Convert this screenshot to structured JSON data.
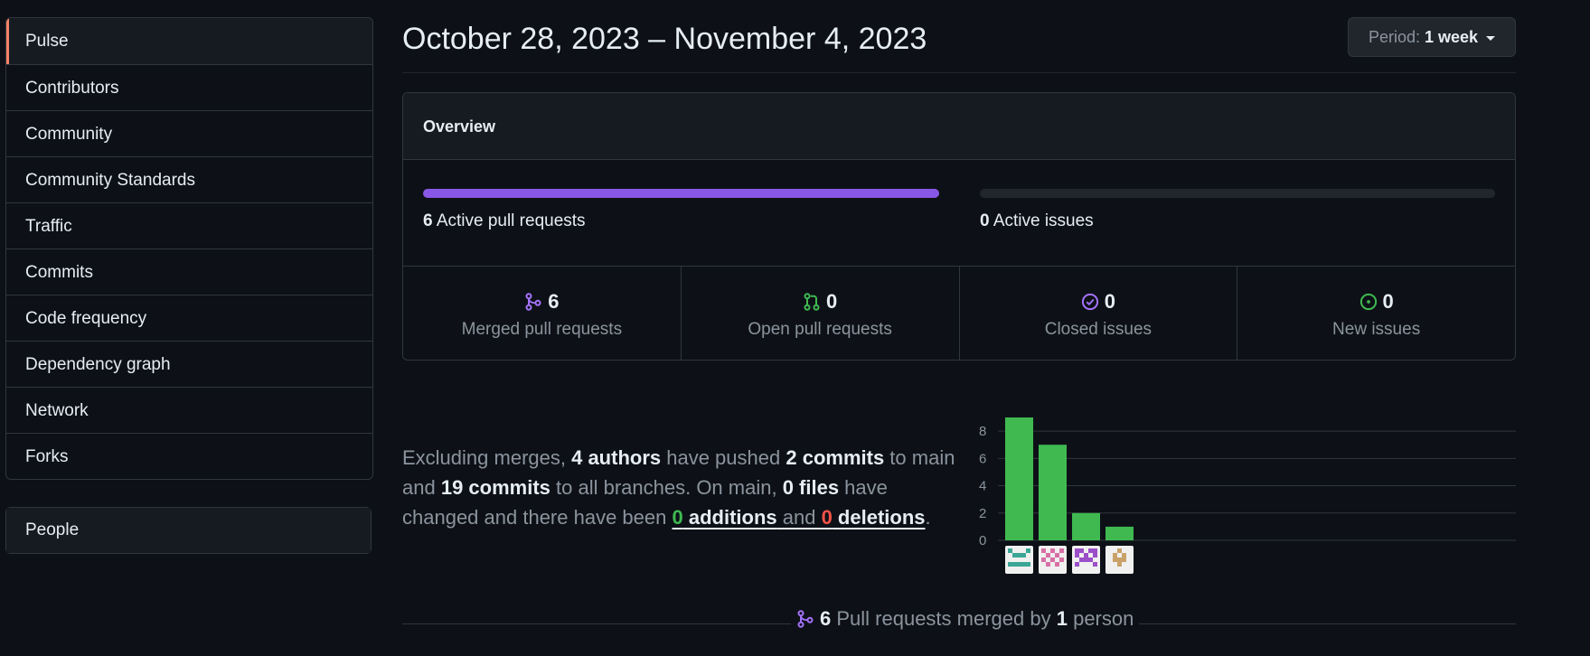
{
  "sidebar": {
    "items": [
      {
        "label": "Pulse"
      },
      {
        "label": "Contributors"
      },
      {
        "label": "Community"
      },
      {
        "label": "Community Standards"
      },
      {
        "label": "Traffic"
      },
      {
        "label": "Commits"
      },
      {
        "label": "Code frequency"
      },
      {
        "label": "Dependency graph"
      },
      {
        "label": "Network"
      },
      {
        "label": "Forks"
      }
    ],
    "selected": "Pulse",
    "people_label": "People",
    "accent_color": "#f78166"
  },
  "header": {
    "title": "October 28, 2023 – November 4, 2023",
    "period_prefix": "Period:",
    "period_value": "1 week"
  },
  "overview": {
    "title": "Overview",
    "active_prs": {
      "count": "6",
      "label": "Active pull requests",
      "fill_fraction": 1.0,
      "color": "#8957e5"
    },
    "active_issues": {
      "count": "0",
      "label": "Active issues",
      "fill_fraction": 0.0
    },
    "stats": [
      {
        "icon": "merge-icon",
        "count": "6",
        "label": "Merged pull requests",
        "color": "#a371f7"
      },
      {
        "icon": "pull-request-icon",
        "count": "0",
        "label": "Open pull requests",
        "color": "#3fb950"
      },
      {
        "icon": "issue-closed-icon",
        "count": "0",
        "label": "Closed issues",
        "color": "#a371f7"
      },
      {
        "icon": "issue-opened-icon",
        "count": "0",
        "label": "New issues",
        "color": "#3fb950"
      }
    ]
  },
  "summary": {
    "t1": "Excluding merges, ",
    "authors": "4 authors",
    "t2": " have pushed ",
    "commits_main": "2 commits",
    "t3": " to main and ",
    "commits_all": "19 commits",
    "t4": " to all branches. On main, ",
    "files": "0 files",
    "t5": " have changed and there have been ",
    "additions_num": "0",
    "additions_word": " additions",
    "t6": " and ",
    "deletions_num": "0",
    "deletions_word": " deletions",
    "t7": "."
  },
  "chart_data": {
    "type": "bar",
    "categories": [
      "author-1",
      "author-2",
      "author-3",
      "author-4"
    ],
    "values": [
      9,
      7,
      2,
      1
    ],
    "ylim": [
      0,
      9
    ],
    "yticks": [
      "0",
      "2",
      "4",
      "6",
      "8"
    ],
    "bar_color": "#3fb950",
    "avatar_colors": [
      "#3aa695",
      "#d770a6",
      "#9b4fc8",
      "#c9a26a"
    ]
  },
  "footer": {
    "count": "6",
    "t1": " Pull requests merged by ",
    "people": "1",
    "t2": " person"
  }
}
